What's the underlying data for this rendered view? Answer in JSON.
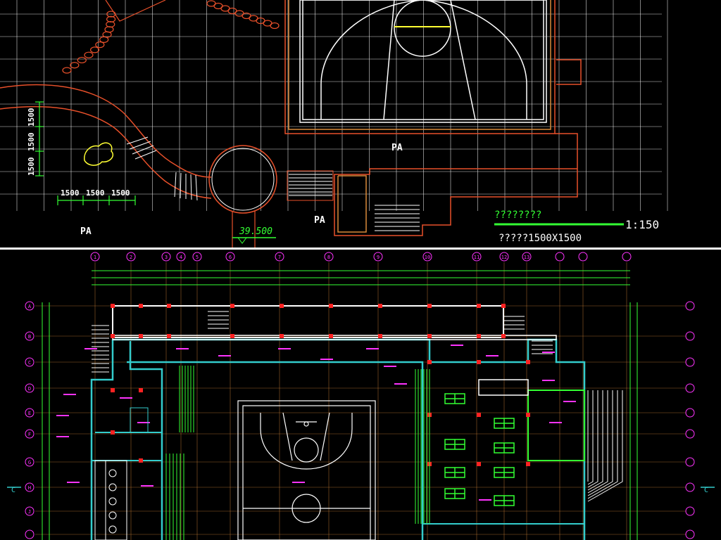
{
  "top_plan": {
    "area_labels": [
      "PA",
      "PA",
      "PA"
    ],
    "elevation": "39.500",
    "dim_vertical": [
      "1500",
      "1500",
      "1500"
    ],
    "dim_horizontal": [
      "1500",
      "1500",
      "1500"
    ],
    "legend_line1": "????????",
    "legend_line2": "?????1500X1500",
    "scale": "1:150"
  },
  "bottom_plan": {
    "grid_axis_labels": [
      "1",
      "2",
      "3",
      "4",
      "5",
      "6",
      "7",
      "8",
      "9",
      "10",
      "11",
      "12",
      "13"
    ],
    "row_axis_labels": [
      "A",
      "B",
      "C",
      "D",
      "E",
      "F",
      "G",
      "H",
      "J"
    ],
    "section_marks": [
      "C",
      "C"
    ]
  },
  "colors": {
    "background": "#000000",
    "grid": "#ffffff",
    "wall_red": "#e8502a",
    "wall_orange": "#d98a3a",
    "green": "#33ff33",
    "magenta": "#ff33ff",
    "cyan": "#33cccc",
    "yellow": "#ffff33"
  }
}
